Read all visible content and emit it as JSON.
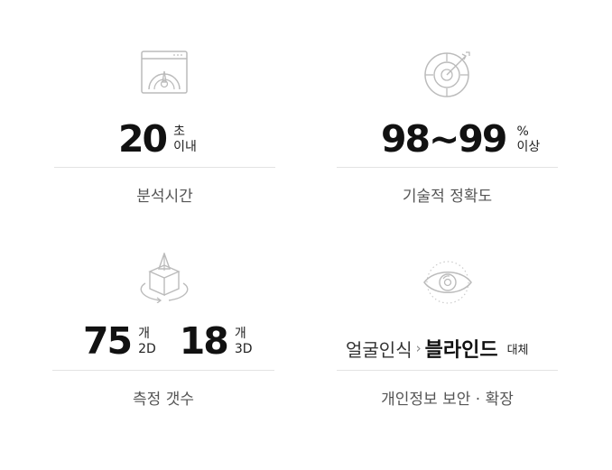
{
  "features": [
    {
      "icon": "dashboard-gauge-icon",
      "value": "20",
      "unit_top": "초",
      "unit_bottom": "이내",
      "label": "분석시간"
    },
    {
      "icon": "target-dart-icon",
      "value": "98~99",
      "unit_top": "%",
      "unit_bottom": "이상",
      "label": "기술적 정확도"
    },
    {
      "icon": "3d-cube-rotate-icon",
      "values": [
        {
          "value": "75",
          "unit_top": "개",
          "unit_bottom": "2D"
        },
        {
          "value": "18",
          "unit_top": "개",
          "unit_bottom": "3D"
        }
      ],
      "label": "측정 갯수"
    },
    {
      "icon": "eye-scan-icon",
      "text_from": "얼굴인식",
      "arrow": "›",
      "text_to": "블라인드",
      "text_suffix": "대체",
      "label": "개인정보 보안 · 확장"
    }
  ]
}
